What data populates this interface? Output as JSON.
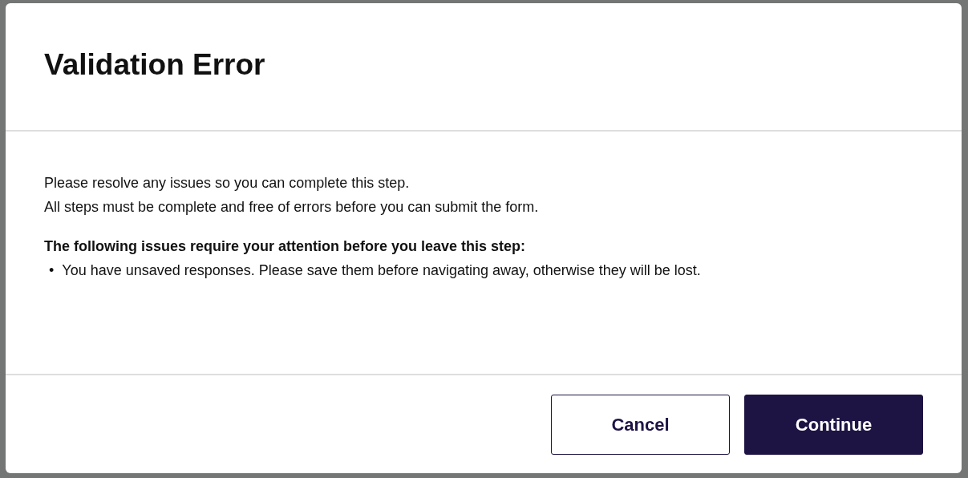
{
  "dialog": {
    "title": "Validation Error",
    "paragraphs": [
      "Please resolve any issues so you can complete this step.",
      "All steps must be complete and free of errors before you can submit the form."
    ],
    "issues_heading": "The following issues require your attention before you leave this step:",
    "issues": [
      {
        "bullet": "•",
        "text": "You have unsaved responses. Please save them before navigating away, otherwise they will be lost."
      }
    ],
    "buttons": [
      {
        "label": "Cancel",
        "kind": "secondary"
      },
      {
        "label": "Continue",
        "kind": "primary"
      }
    ]
  }
}
